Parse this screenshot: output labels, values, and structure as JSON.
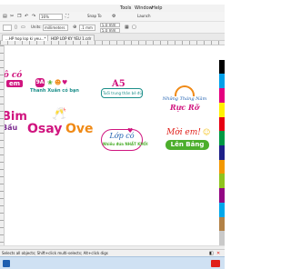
{
  "menu": {
    "tools": "Tools",
    "window": "Window",
    "help": "Help"
  },
  "toolbar1": {
    "zoom": "16%",
    "snap": "Snap To",
    "launch": "Launch"
  },
  "toolbar2": {
    "units_label": "Units:",
    "units_value": "millimeters",
    "nudge": ".1 mm",
    "dup_x": "5.0 mm",
    "dup_y": "5.0 mm"
  },
  "tabs": [
    "...HP hop lop ki yeu...*",
    "HOP LOP KY YEU 1.cdr"
  ],
  "stickers": {
    "top_left": "ô có",
    "top_left_line2": "em",
    "thanh_xuan": "Thanh Xuân có bạn",
    "a5": "A5",
    "a5_sub": "Tuổi trung thân bè đủ",
    "nhung_thang_nam": "Những Tháng Năm",
    "ruc_ro": "Rực Rỡ",
    "bim": "Bim",
    "bim_sub": "Bầu",
    "osay": "Osay",
    "ove": "Ove",
    "lop_co": "Lớp có",
    "lop_co_sub": "Nhiều đứa NHẤT KHỐI",
    "moi_em": "Mời em!",
    "len_bang": "Lên Bảng"
  },
  "status": "Selects all objects; Shift+click multi-selects; Alt+click digs",
  "colors": {
    "magenta": "#d0157f",
    "orange": "#f08a16",
    "teal": "#1c8f8a",
    "purple": "#7a2a8f",
    "red": "#e0201a",
    "blue": "#1e5fb0",
    "green": "#4cae2c",
    "yellow": "#f4c21a"
  },
  "palette": [
    "#ffffff",
    "#000000",
    "#00a0e9",
    "#e4007f",
    "#fff100",
    "#e60012",
    "#009944",
    "#1d2088",
    "#f39800",
    "#8fc31f",
    "#920783",
    "#00a7ea",
    "#b28146",
    "#c9c9c9"
  ]
}
